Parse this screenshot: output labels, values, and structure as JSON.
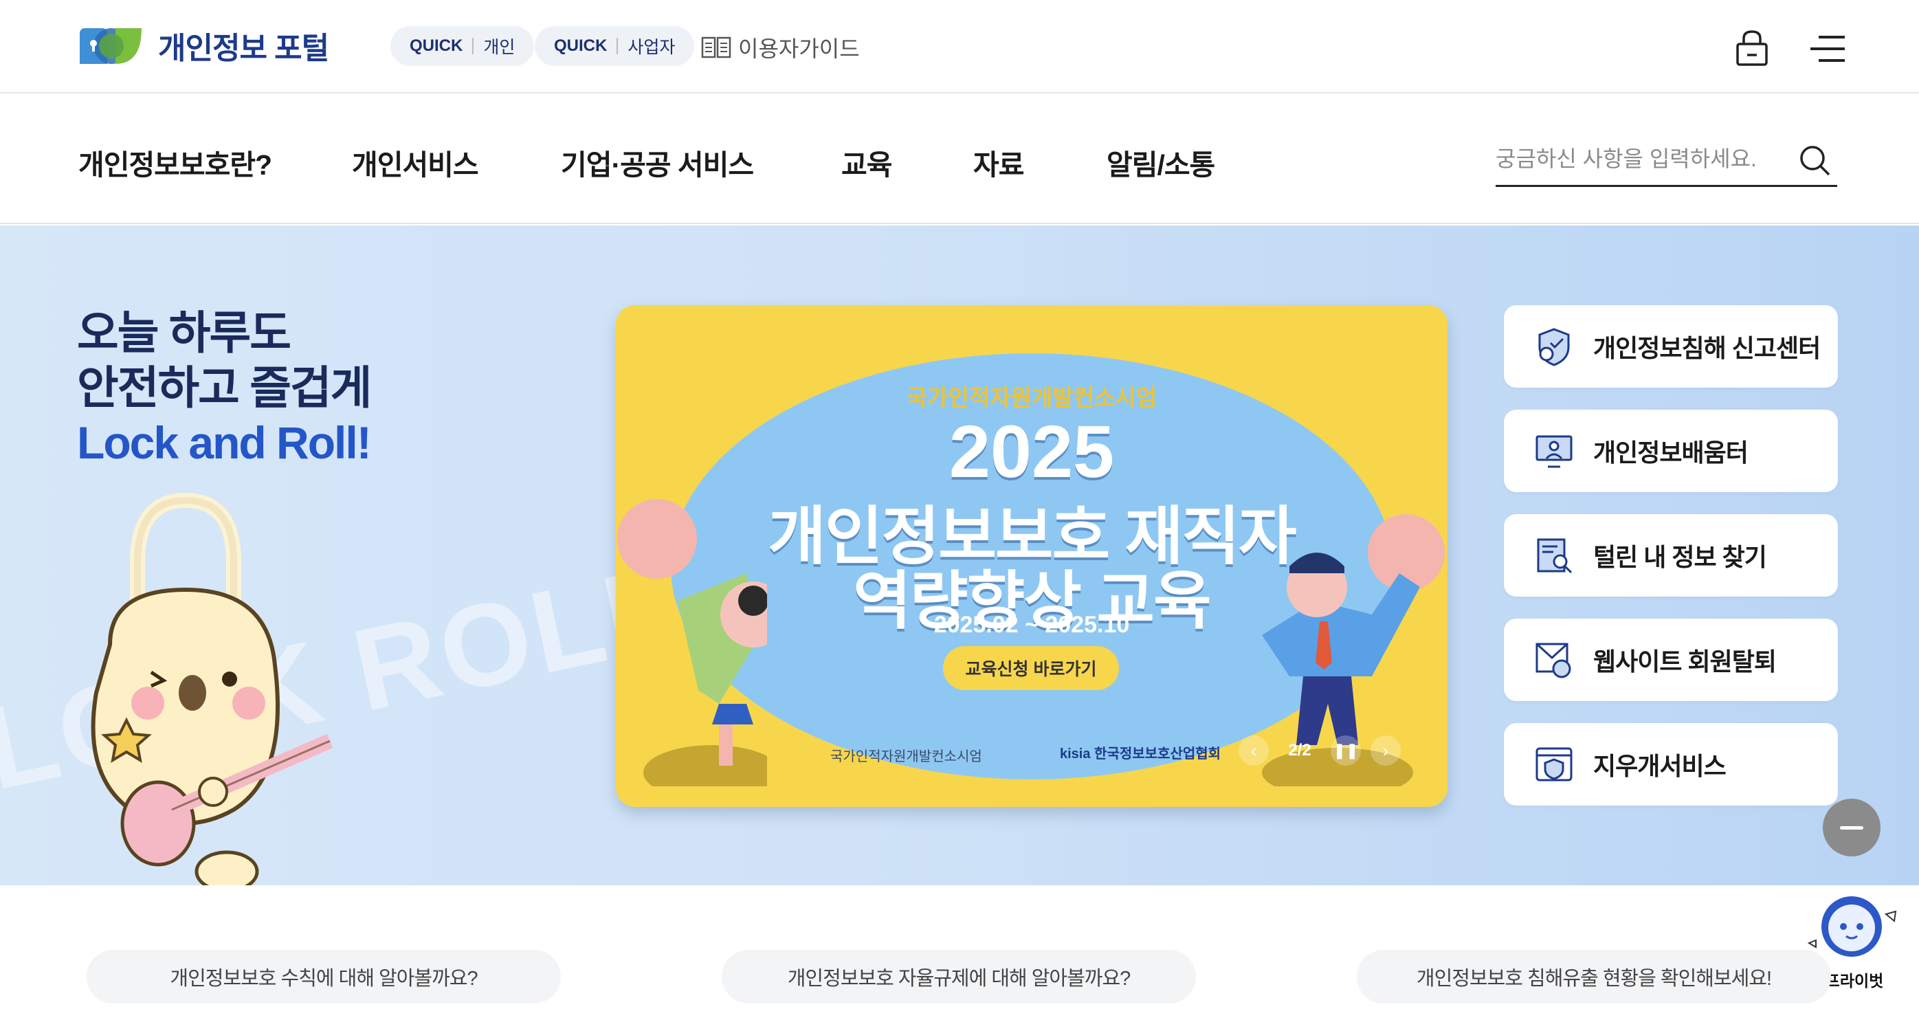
{
  "header": {
    "logo_text": "개인정보 포털",
    "quick_personal": {
      "tag": "QUICK",
      "label": "개인"
    },
    "quick_business": {
      "tag": "QUICK",
      "label": "사업자"
    },
    "guide_label": "이용자가이드"
  },
  "nav": {
    "items": [
      "개인정보보호란?",
      "개인서비스",
      "기업·공공 서비스",
      "교육",
      "자료",
      "알림/소통"
    ],
    "search_placeholder": "궁금하신 사항을 입력하세요."
  },
  "hero": {
    "line1": "오늘 하루도",
    "line2": "안전하고 즐겁게",
    "line3": "Lock and Roll!",
    "bg_word": "LOCK ROLL"
  },
  "banner": {
    "org": "국가인적자원개발컨소시엄",
    "year": "2025",
    "title1": "개인정보보호 재직자",
    "title2": "역량향상 교육",
    "dates": "2025.02 ~ 2025.10",
    "cta": "교육신청 바로가기",
    "footer_logo1": "국가인적자원개발컨소시엄",
    "footer_logo2": "kisia 한국정보보호산업협회",
    "counter": "2/2"
  },
  "quick_links": [
    {
      "label": "개인정보침해 신고센터",
      "icon": "shield-user-icon"
    },
    {
      "label": "개인정보배움터",
      "icon": "monitor-teacher-icon"
    },
    {
      "label": "털린 내 정보 찾기",
      "icon": "document-search-icon"
    },
    {
      "label": "웹사이트 회원탈퇴",
      "icon": "envelope-lock-icon"
    },
    {
      "label": "지우개서비스",
      "icon": "browser-shield-icon"
    }
  ],
  "chatbot": {
    "name": "프라이벗"
  },
  "bottom_chips": [
    "개인정보보호 수칙에 대해 알아볼까요?",
    "개인정보보호 자율규제에 대해 알아볼까요?",
    "개인정보보호 침해유출 현황을 확인해보세요!"
  ],
  "colors": {
    "brand_navy": "#1d3a8a",
    "hero_bg": "#cfe2f7",
    "banner_yellow": "#f7d64c",
    "accent_blue": "#2456c8"
  }
}
